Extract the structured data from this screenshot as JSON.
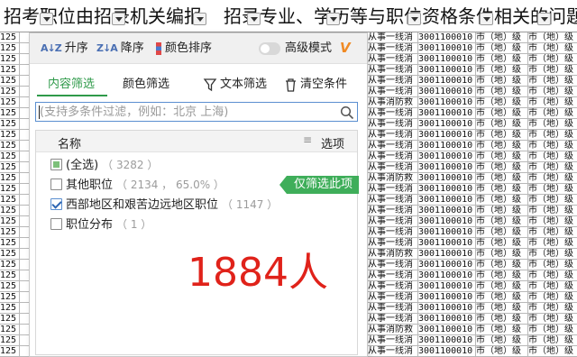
{
  "spreadsheet": {
    "header_cells": [
      "招考职位由招录机关编报",
      "招录专业、学历等与职位资格条件相关的问题"
    ],
    "row_number_prefix": "125",
    "row_cells": [
      "从事一线消",
      "3001100010",
      "市（地）级",
      "市（地）级"
    ],
    "row_cells_alt": [
      "从事消防救",
      "3001100010",
      "市（地）级",
      "市（地）级"
    ]
  },
  "filter_panel": {
    "sort_ascending_label": "升序",
    "sort_descending_label": "降序",
    "color_sort_label": "颜色排序",
    "advanced_mode_label": "高级模式",
    "advanced_mode_on": false,
    "vip_icon_text": "V",
    "tabs": [
      {
        "label": "内容筛选",
        "active": true
      },
      {
        "label": "颜色筛选",
        "active": false
      }
    ],
    "text_filter_label": "文本筛选",
    "clear_conditions_label": "清空条件",
    "search": {
      "value": "",
      "placeholder": "(支持多条件过滤，例如：北京 上海)"
    },
    "list_header": {
      "name_label": "名称",
      "menu_icon_text": "≡",
      "options_label": "选项"
    },
    "items": [
      {
        "label": "(全选)",
        "count": "（ 3282 ）",
        "state": "partial"
      },
      {
        "label": "其他职位",
        "count": "（ 2134 ， 65.0% ）",
        "state": "unchecked"
      },
      {
        "label": "西部地区和艰苦边远地区职位",
        "count": "（ 1147 ）",
        "state": "checked"
      },
      {
        "label": "职位分布",
        "count": "（ 1 ）",
        "state": "unchecked"
      }
    ],
    "only_filter_label": "仅筛选此项"
  },
  "overlay": {
    "count_text": "1884人",
    "color": "#e0221a"
  },
  "colors": {
    "accent_green": "#2f9a4a",
    "only_filter_green": "#3fae5a",
    "search_border": "#5b8fd0",
    "vip_orange": "#f08a24"
  }
}
